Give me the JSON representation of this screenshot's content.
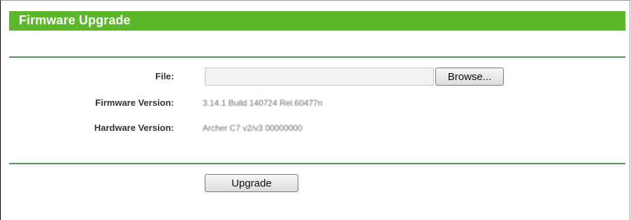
{
  "header": {
    "title": "Firmware Upgrade"
  },
  "form": {
    "file_label": "File:",
    "file_value": "",
    "browse_label": "Browse...",
    "firmware_label": "Firmware Version:",
    "firmware_value": "3.14.1 Build 140724 Rel.60477n",
    "hardware_label": "Hardware Version:",
    "hardware_value": "Archer C7 v2/v3 00000000"
  },
  "actions": {
    "upgrade_label": "Upgrade"
  },
  "colors": {
    "title_bar": "#5cb82a",
    "divider": "#4f9a56",
    "title_text": "#ffffff"
  }
}
